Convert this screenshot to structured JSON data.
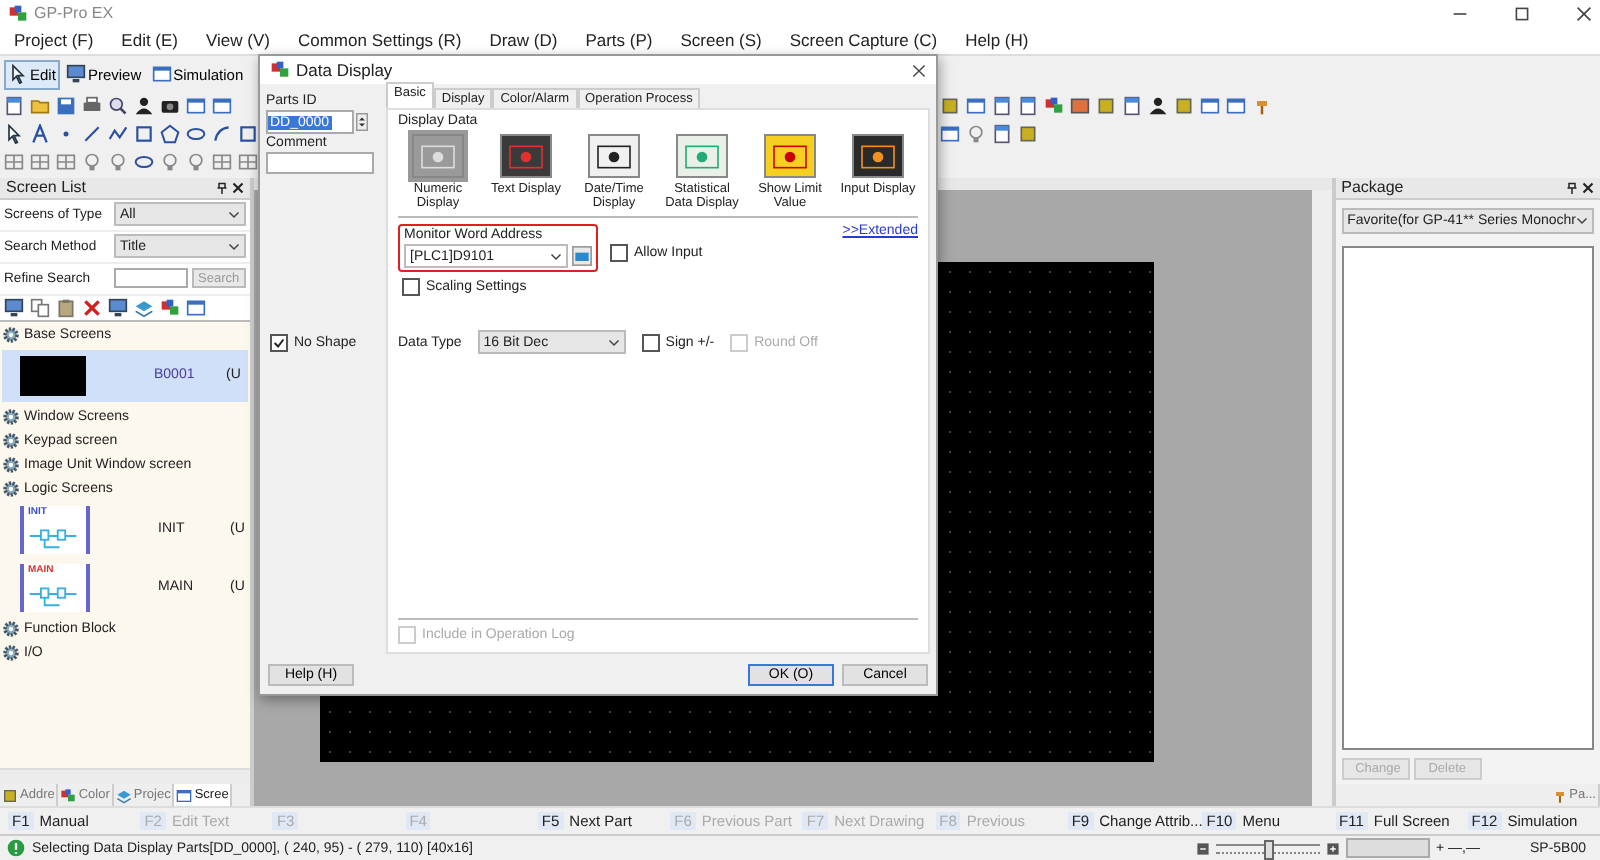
{
  "window": {
    "title": "GP-Pro EX"
  },
  "menu": [
    {
      "label": "Project (F)"
    },
    {
      "label": "Edit (E)"
    },
    {
      "label": "View (V)"
    },
    {
      "label": "Common Settings (R)"
    },
    {
      "label": "Draw (D)"
    },
    {
      "label": "Parts (P)"
    },
    {
      "label": "Screen (S)"
    },
    {
      "label": "Screen Capture (C)"
    },
    {
      "label": "Help (H)"
    }
  ],
  "toolbar": {
    "modes": [
      {
        "kind": "edit",
        "label": "Edit",
        "selected": true
      },
      {
        "kind": "preview",
        "label": "Preview",
        "selected": false
      },
      {
        "kind": "simulation",
        "label": "Simulation",
        "selected": false
      }
    ]
  },
  "screen_list": {
    "title": "Screen List",
    "filters": [
      {
        "label": "Screens of Type",
        "value": "All"
      },
      {
        "label": "Search Method",
        "value": "Title"
      }
    ],
    "refine": {
      "label": "Refine Search",
      "button": "Search",
      "disabled": true
    },
    "tree": [
      {
        "label": "Base Screens",
        "children": [
          {
            "kind": "base",
            "name": "B0001",
            "suffix": "(U",
            "selected": true
          }
        ]
      },
      {
        "label": "Window Screens"
      },
      {
        "label": "Keypad screen"
      },
      {
        "label": "Image Unit Window screen"
      },
      {
        "label": "Logic Screens",
        "children": [
          {
            "kind": "logic",
            "thumb": "INIT",
            "color": "#3a4fd0",
            "name": "INIT",
            "suffix": "(U",
            "selected": false
          },
          {
            "kind": "logic",
            "thumb": "MAIN",
            "color": "#e03030",
            "name": "MAIN",
            "suffix": "(U",
            "selected": false
          }
        ]
      },
      {
        "label": "Function Block"
      },
      {
        "label": "I/O"
      }
    ],
    "tabs": [
      {
        "label": "Addre",
        "selected": false
      },
      {
        "label": "Color",
        "selected": false
      },
      {
        "label": "Projec",
        "selected": false
      },
      {
        "label": "Scree",
        "selected": true
      }
    ]
  },
  "dialog": {
    "title": "Data Display",
    "parts_id": {
      "label": "Parts ID",
      "value": "DD_0000"
    },
    "comment": {
      "label": "Comment"
    },
    "no_shape": {
      "label": "No Shape",
      "checked": true
    },
    "tabs": [
      {
        "label": "Basic",
        "selected": true
      },
      {
        "label": "Display",
        "selected": false
      },
      {
        "label": "Color/Alarm",
        "selected": false
      },
      {
        "label": "Operation Process",
        "selected": false
      }
    ],
    "display_data": {
      "title": "Display Data",
      "types": [
        {
          "kind": "numeric",
          "label": "Numeric Display",
          "selected": true
        },
        {
          "kind": "text",
          "label": "Text Display",
          "selected": false
        },
        {
          "kind": "datetime",
          "label": "Date/Time Display",
          "selected": false
        },
        {
          "kind": "statistics",
          "label": "Statistical Data Display",
          "selected": false
        },
        {
          "kind": "limit",
          "label": "Show Limit Value",
          "selected": false
        },
        {
          "kind": "input",
          "label": "Input Display",
          "selected": false
        }
      ]
    },
    "extended": ">>Extended",
    "monitor": {
      "label": "Monitor Word Address",
      "value": "[PLC1]D9101"
    },
    "allow_input": {
      "label": "Allow Input",
      "checked": false
    },
    "scaling": {
      "label": "Scaling Settings",
      "checked": false
    },
    "data_type": {
      "label": "Data Type",
      "value": "16 Bit Dec"
    },
    "sign": {
      "label": "Sign +/-",
      "checked": false
    },
    "round_off": {
      "label": "Round Off",
      "checked": false,
      "disabled": true
    },
    "operation_log": {
      "label": "Include in Operation Log",
      "checked": false,
      "disabled": true
    },
    "buttons": [
      {
        "kind": "help",
        "label": "Help (H)"
      },
      {
        "kind": "ok",
        "label": "OK (O)"
      },
      {
        "kind": "cancel",
        "label": "Cancel"
      }
    ]
  },
  "package": {
    "title": "Package",
    "selection": "Favorite(for GP-41** Series Monochr",
    "buttons": [
      {
        "label": "Change",
        "disabled": true
      },
      {
        "label": "Delete",
        "disabled": true
      }
    ],
    "tab": "Pa..."
  },
  "function_keys": [
    {
      "key": "F1",
      "label": "Manual",
      "disabled": false
    },
    {
      "key": "F2",
      "label": "Edit Text",
      "disabled": true
    },
    {
      "key": "F3",
      "disabled": true
    },
    {
      "key": "F4",
      "disabled": true
    },
    {
      "key": "F5",
      "label": "Next Part",
      "disabled": false
    },
    {
      "key": "F6",
      "label": "Previous Part",
      "disabled": true
    },
    {
      "key": "F7",
      "label": "Next Drawing",
      "disabled": true
    },
    {
      "key": "F8",
      "label": "Previous",
      "disabled": true
    },
    {
      "key": "F9",
      "label": "Change Attrib...",
      "disabled": false
    },
    {
      "key": "F10",
      "label": "Menu",
      "disabled": false
    },
    {
      "key": "F11",
      "label": "Full Screen",
      "disabled": false
    },
    {
      "key": "F12",
      "label": "Simulation",
      "disabled": false
    }
  ],
  "status_bar": {
    "message": "Selecting Data Display Parts[DD_0000], ( 240, 95) - ( 279, 110) [40x16]",
    "zoom": {
      "level": 0.5
    },
    "cursor": "+ —,—",
    "model": "SP-5B00"
  }
}
